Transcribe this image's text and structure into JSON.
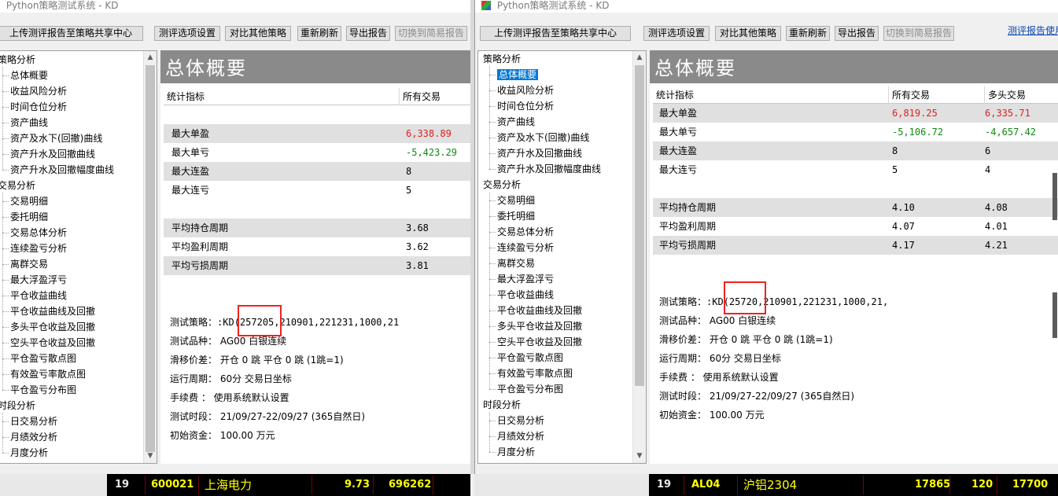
{
  "left": {
    "title": "Python策略测试系统 - KD",
    "toolbar": {
      "upload": "上传测评报告至策略共享中心",
      "options": "测评选项设置",
      "compare": "对比其他策略",
      "refresh": "重新刷新",
      "export": "导出报告",
      "switch": "切换到简易报告"
    },
    "tree": [
      "策略分析",
      "总体概要",
      "收益风险分析",
      "时间仓位分析",
      "资产曲线",
      "资产及水下(回撤)曲线",
      "资产升水及回撤曲线",
      "资产升水及回撤幅度曲线",
      "交易分析",
      "交易明细",
      "委托明细",
      "交易总体分析",
      "连续盈亏分析",
      "离群交易",
      "最大浮盈浮亏",
      "平仓收益曲线",
      "平仓收益曲线及回撤",
      "多头平仓收益及回撤",
      "空头平仓收益及回撤",
      "平仓盈亏散点图",
      "有效盈亏率散点图",
      "平仓盈亏分布图",
      "时段分析",
      "日交易分析",
      "月绩效分析",
      "月度分析"
    ],
    "panel_title": "总体概要",
    "columns": [
      "统计指标",
      "所有交易"
    ],
    "rows": [
      {
        "label": "最大单盈",
        "all": "6,338.89"
      },
      {
        "label": "最大单亏",
        "all": "-5,423.29"
      },
      {
        "label": "最大连盈",
        "all": "8"
      },
      {
        "label": "最大连亏",
        "all": "5"
      },
      {
        "label": "平均持仓周期",
        "all": "3.68"
      },
      {
        "label": "平均盈利周期",
        "all": "3.62"
      },
      {
        "label": "平均亏损周期",
        "all": "3.81"
      }
    ],
    "info": {
      "strategy_label": "测试策略：",
      "strategy_value": ":KD(257205,210901,221231,1000,21",
      "product": "测试品种： AG00 白银连续",
      "slippage": "滑移价差： 开仓 0 跳 平仓 0 跳 (1跳=1)",
      "period": "运行周期： 60分 交易日坐标",
      "fee": "手续费  ： 使用系统默认设置",
      "range": "测试时段： 21/09/27-22/09/27 (365自然日)",
      "capital": "初始资金： 100.00 万元"
    },
    "ticker": {
      "num": "19",
      "code": "600021",
      "name": "上海电力",
      "price": "9.73",
      "vol": "696262"
    }
  },
  "right": {
    "title": "Python策略测试系统 - KD",
    "toolbar": {
      "upload": "上传测评报告至策略共享中心",
      "options": "测评选项设置",
      "compare": "对比其他策略",
      "refresh": "重新刷新",
      "export": "导出报告",
      "switch": "切换到简易报告",
      "link": "测评报告使用"
    },
    "tree": [
      "策略分析",
      "总体概要",
      "收益风险分析",
      "时间仓位分析",
      "资产曲线",
      "资产及水下(回撤)曲线",
      "资产升水及回撤曲线",
      "资产升水及回撤幅度曲线",
      "交易分析",
      "交易明细",
      "委托明细",
      "交易总体分析",
      "连续盈亏分析",
      "离群交易",
      "最大浮盈浮亏",
      "平仓收益曲线",
      "平仓收益曲线及回撤",
      "多头平仓收益及回撤",
      "空头平仓收益及回撤",
      "平仓盈亏散点图",
      "有效盈亏率散点图",
      "平仓盈亏分布图",
      "时段分析",
      "日交易分析",
      "月绩效分析",
      "月度分析"
    ],
    "panel_title": "总体概要",
    "columns": [
      "统计指标",
      "所有交易",
      "多头交易"
    ],
    "rows": [
      {
        "label": "最大单盈",
        "all": "6,819.25",
        "long": "6,335.71"
      },
      {
        "label": "最大单亏",
        "all": "-5,106.72",
        "long": "-4,657.42"
      },
      {
        "label": "最大连盈",
        "all": "8",
        "long": "6"
      },
      {
        "label": "最大连亏",
        "all": "5",
        "long": "4"
      },
      {
        "label": "平均持仓周期",
        "all": "4.10",
        "long": "4.08"
      },
      {
        "label": "平均盈利周期",
        "all": "4.07",
        "long": "4.01"
      },
      {
        "label": "平均亏损周期",
        "all": "4.17",
        "long": "4.21"
      }
    ],
    "info": {
      "strategy_label": "测试策略：",
      "strategy_value": ":KD(25720,210901,221231,1000,21,",
      "product": "测试品种： AG00 白银连续",
      "slippage": "滑移价差： 开仓 0 跳 平仓 0 跳 (1跳=1)",
      "period": "运行周期： 60分 交易日坐标",
      "fee": "手续费  ： 使用系统默认设置",
      "range": "测试时段： 21/09/27-22/09/27 (365自然日)",
      "capital": "初始资金： 100.00 万元"
    },
    "ticker": {
      "num": "19",
      "code": "AL04",
      "name": "沪铝2304",
      "price": "17865",
      "vol": "120",
      "extra": "17700"
    }
  },
  "colors": {
    "red": "#e02020",
    "green": "#118811",
    "ticker_yellow": "#ffff00",
    "ticker_text": "#e8e8e8",
    "highlight_box": "#e22222"
  },
  "icons": {
    "app": "app-logo-icon",
    "scroll_up": "chevron-up-icon",
    "scroll_down": "chevron-down-icon"
  }
}
